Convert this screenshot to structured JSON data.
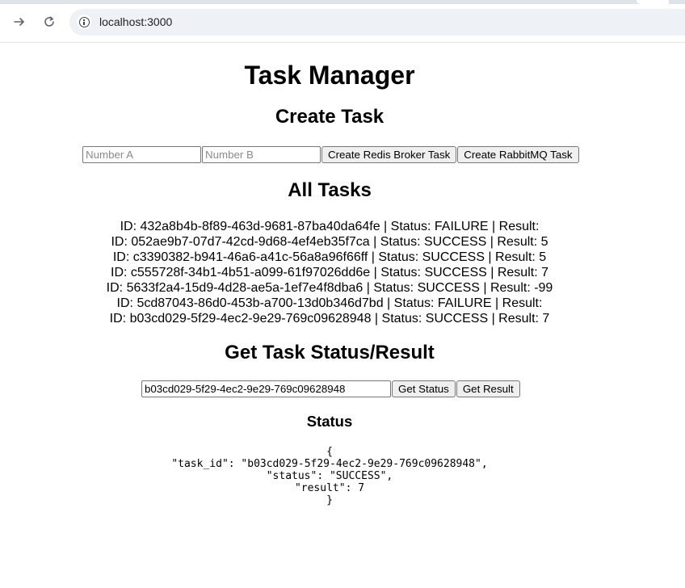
{
  "browser": {
    "url": "localhost:3000",
    "icons": {
      "forward": "forward-arrow-icon",
      "reload": "reload-icon",
      "site_info": "info-icon"
    }
  },
  "page": {
    "title": "Task Manager",
    "create": {
      "heading": "Create Task",
      "number_a_placeholder": "Number A",
      "number_b_placeholder": "Number B",
      "number_a_value": "",
      "number_b_value": "",
      "redis_button": "Create Redis Broker Task",
      "rabbitmq_button": "Create RabbitMQ Task"
    },
    "all_tasks": {
      "heading": "All Tasks",
      "items": [
        "ID: 432a8b4b-8f89-463d-9681-87ba40da64fe | Status: FAILURE | Result:",
        "ID: 052ae9b7-07d7-42cd-9d68-4ef4eb35f7ca | Status: SUCCESS | Result: 5",
        "ID: c3390382-b941-46a6-a41c-56a8a96f66ff | Status: SUCCESS | Result: 5",
        "ID: c555728f-34b1-4b51-a099-61f97026dd6e | Status: SUCCESS | Result: 7",
        "ID: 5633f2a4-15d9-4d28-ae5a-1ef7e4f8dba6 | Status: SUCCESS | Result: -99",
        "ID: 5cd87043-86d0-453b-a700-13d0b346d7bd | Status: FAILURE | Result:",
        "ID: b03cd029-5f29-4ec2-9e29-769c09628948 | Status: SUCCESS | Result: 7"
      ]
    },
    "get": {
      "heading": "Get Task Status/Result",
      "task_id_value": "b03cd029-5f29-4ec2-9e29-769c09628948",
      "status_button": "Get Status",
      "result_button": "Get Result"
    },
    "status": {
      "heading": "Status",
      "json_text": "{\n\"task_id\": \"b03cd029-5f29-4ec2-9e29-769c09628948\",\n\"status\": \"SUCCESS\",\n\"result\": 7\n}"
    }
  }
}
